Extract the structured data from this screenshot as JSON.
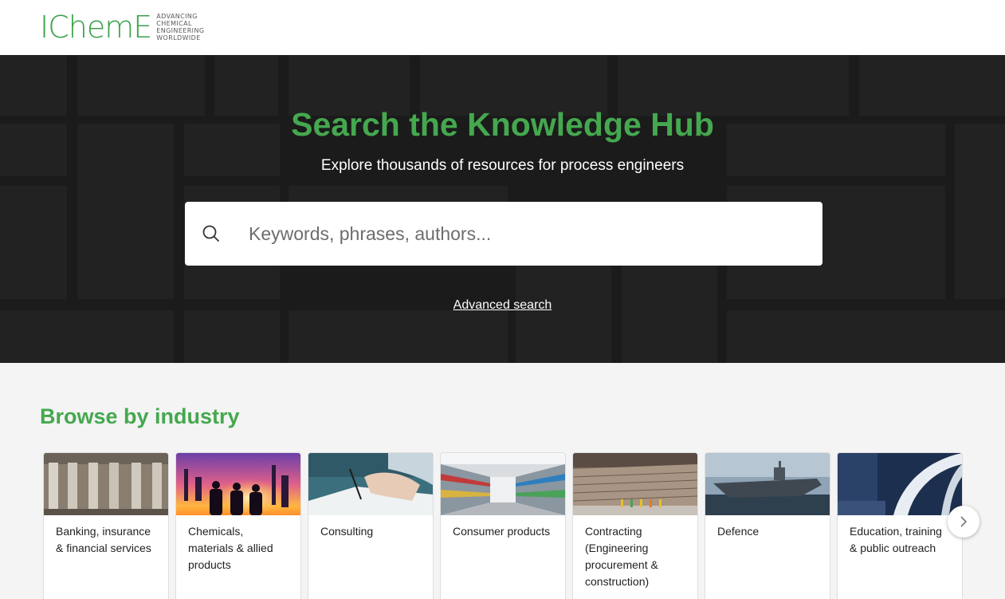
{
  "header": {
    "logo_text": "IChemE",
    "logo_tagline": [
      "ADVANCING",
      "CHEMICAL",
      "ENGINEERING",
      "WORLDWIDE"
    ]
  },
  "hero": {
    "title": "Search the Knowledge Hub",
    "subtitle": "Explore thousands of resources for process engineers",
    "search_placeholder": "Keywords, phrases, authors...",
    "search_value": "",
    "advanced_search_label": "Advanced search"
  },
  "browse": {
    "title": "Browse by industry",
    "industries": [
      {
        "label": "Banking, insurance & financial services",
        "image": "columns-building-image"
      },
      {
        "label": "Chemicals, materials & allied products",
        "image": "engineers-silhouette-image"
      },
      {
        "label": "Consulting",
        "image": "hand-writing-image"
      },
      {
        "label": "Consumer products",
        "image": "supermarket-aisle-image"
      },
      {
        "label": "Contracting (Engineering procurement & construction)",
        "image": "construction-site-image"
      },
      {
        "label": "Defence",
        "image": "aircraft-carrier-image"
      },
      {
        "label": "Education, training & public outreach",
        "image": "modern-architecture-image"
      }
    ],
    "next_icon": "chevron-right-icon"
  },
  "colors": {
    "brand_green": "#45a84f",
    "hero_background": "#1b1b1b"
  }
}
